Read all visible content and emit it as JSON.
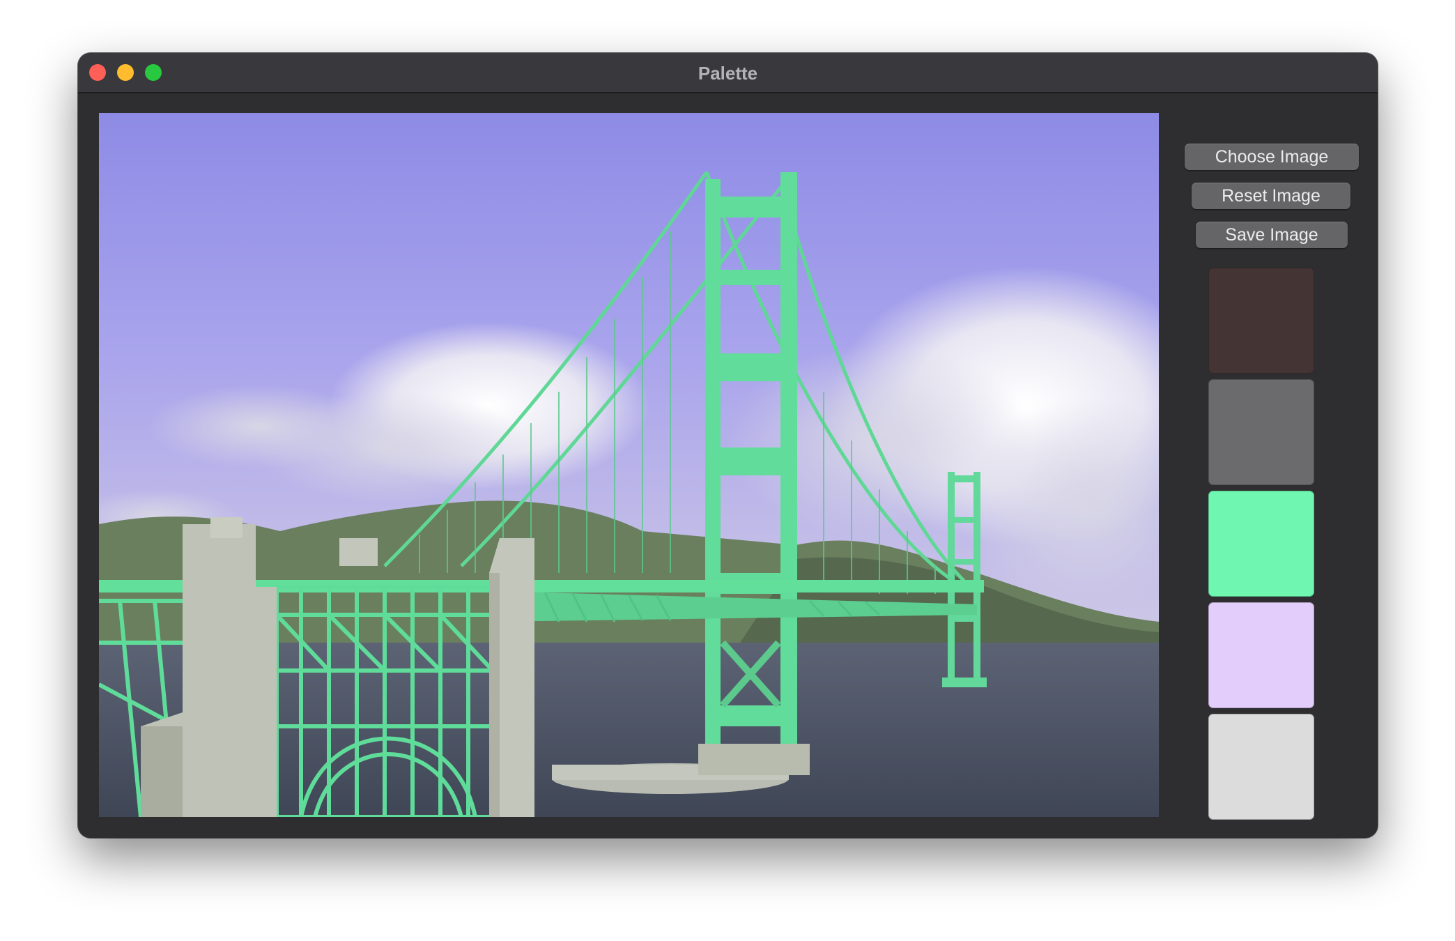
{
  "window": {
    "title": "Palette"
  },
  "image_view": {
    "description_icon": "photo-image",
    "colors": {
      "sky_top": "#8f8ce8",
      "sky_horizon": "#c7c2e8",
      "bridge": "#62dc9a",
      "water": "#4a5264",
      "hills": "#667a5c",
      "pier": "#b8bdb0"
    }
  },
  "buttons": {
    "choose": "Choose Image",
    "reset": "Reset Image",
    "save": "Save Image"
  },
  "palette": {
    "swatches": [
      {
        "color": "#443434"
      },
      {
        "color": "#6b6b6d"
      },
      {
        "color": "#6ff7b2"
      },
      {
        "color": "#e3cdfa"
      },
      {
        "color": "#dcdcdc"
      }
    ]
  },
  "traffic_lights": {
    "close": "#fe5f57",
    "minimize": "#febc2e",
    "maximize": "#28c840"
  }
}
